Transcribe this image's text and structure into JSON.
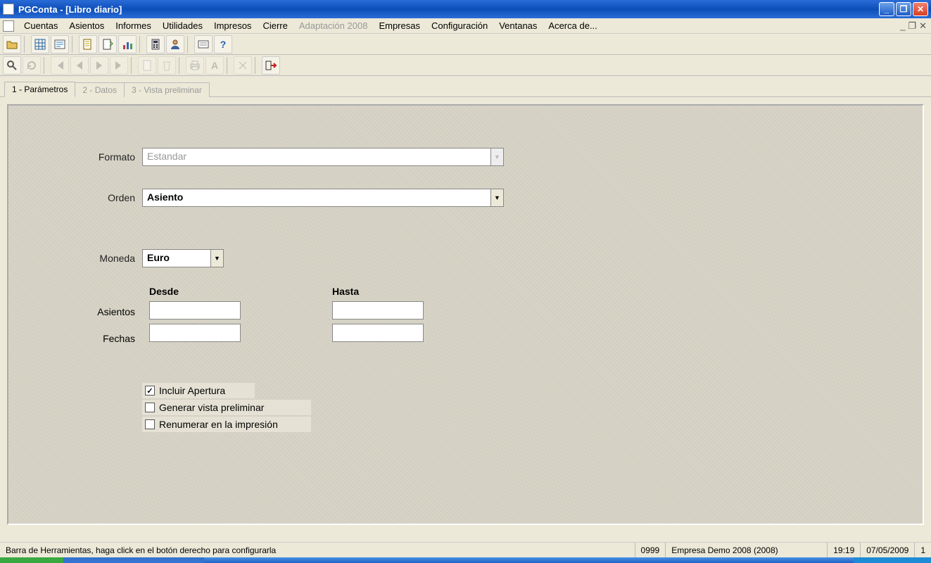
{
  "title": "PGConta - [Libro diario]",
  "menu": {
    "items": [
      "Cuentas",
      "Asientos",
      "Informes",
      "Utilidades",
      "Impresos",
      "Cierre",
      "Adaptación 2008",
      "Empresas",
      "Configuración",
      "Ventanas",
      "Acerca de..."
    ],
    "disabled_index": 6
  },
  "tabs": {
    "t1": "1 - Parámetros",
    "t2": "2 - Datos",
    "t3": "3 - Vista preliminar"
  },
  "form": {
    "formato_label": "Formato",
    "formato_value": "Estandar",
    "orden_label": "Orden",
    "orden_value": "Asiento",
    "moneda_label": "Moneda",
    "moneda_value": "Euro",
    "desde_label": "Desde",
    "hasta_label": "Hasta",
    "asientos_label": "Asientos",
    "fechas_label": "Fechas",
    "asientos_desde": "",
    "asientos_hasta": "",
    "fechas_desde": "",
    "fechas_hasta": "",
    "chk1": "Incluir Apertura",
    "chk2": "Generar vista preliminar",
    "chk3": "Renumerar en la impresión",
    "chk1_checked": true,
    "chk2_checked": false,
    "chk3_checked": false
  },
  "status": {
    "hint": "Barra de Herramientas, haga click en el botón derecho para configurarla",
    "code": "0999",
    "company": "Empresa Demo 2008 (2008)",
    "time": "19:19",
    "date": "07/05/2009",
    "last": "1"
  }
}
